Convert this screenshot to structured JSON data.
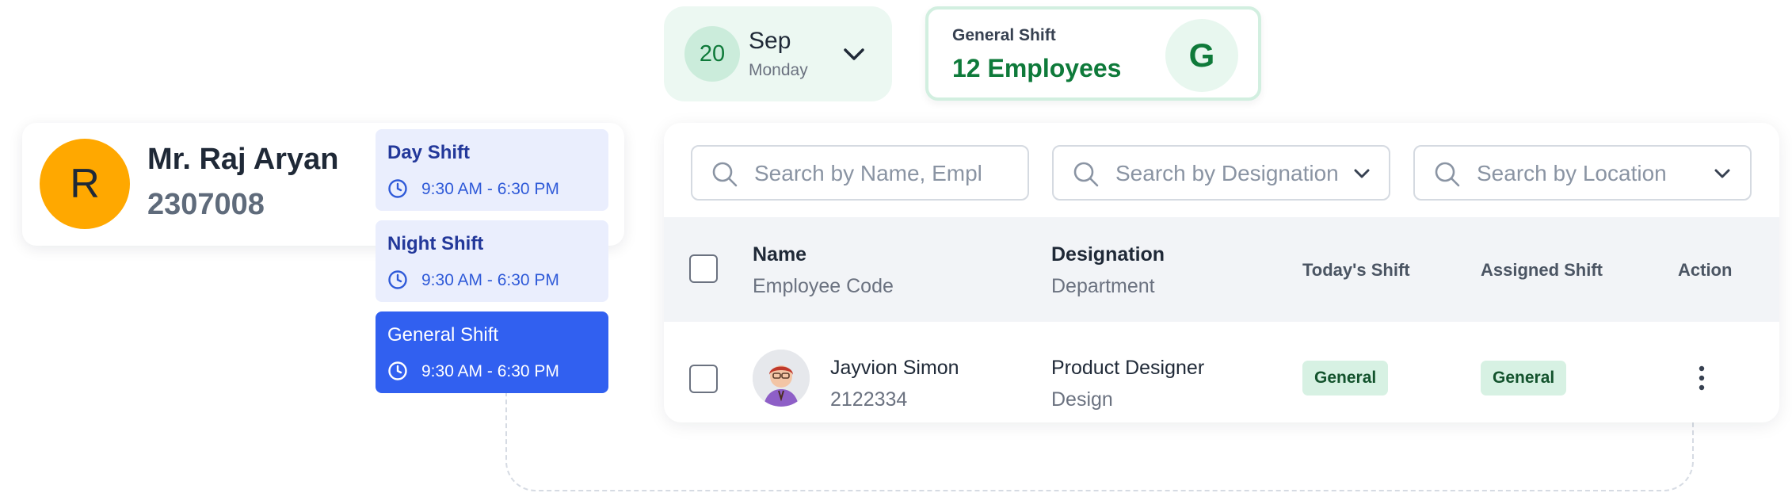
{
  "date_picker": {
    "day_number": "20",
    "month": "Sep",
    "weekday": "Monday"
  },
  "shift_summary": {
    "label": "General Shift",
    "count": "12 Employees",
    "badge": "G"
  },
  "profile": {
    "initial": "R",
    "name": "Mr. Raj Aryan",
    "code": "2307008"
  },
  "shift_options": [
    {
      "title": "Day Shift",
      "time": "9:30 AM - 6:30 PM",
      "selected": false
    },
    {
      "title": "Night Shift",
      "time": "9:30 AM - 6:30 PM",
      "selected": false
    },
    {
      "title": "General Shift",
      "time": "9:30 AM - 6:30 PM",
      "selected": true
    }
  ],
  "search": {
    "name_placeholder": "Search by Name, Empl...",
    "designation_placeholder": "Search by Designation",
    "location_placeholder": "Search by Location"
  },
  "table": {
    "headers": {
      "name": "Name",
      "employee_code": "Employee Code",
      "designation": "Designation",
      "department": "Department",
      "todays_shift": "Today's Shift",
      "assigned_shift": "Assigned Shift",
      "action": "Action"
    },
    "rows": [
      {
        "name": "Jayvion Simon",
        "code": "2122334",
        "designation": "Product Designer",
        "department": "Design",
        "todays_shift": "General",
        "assigned_shift": "General"
      }
    ]
  },
  "colors": {
    "accent_blue": "#3160f0",
    "accent_green": "#0e7a3a",
    "avatar_orange": "#ffa800",
    "badge_green_bg": "#d7f1e3"
  },
  "icons": {
    "date_dropdown": "chevron-down-icon",
    "shift_time": "clock-icon",
    "search": "search-icon",
    "row_actions": "more-vertical-icon"
  }
}
